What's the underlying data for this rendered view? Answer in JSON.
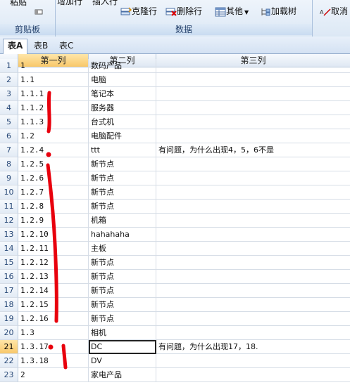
{
  "ribbon": {
    "clipboard_group": "剪贴板",
    "data_group": "数据",
    "paste_label": "粘贴",
    "append_label": "增加行",
    "insert_label": "插入行",
    "clone_label": "克隆行",
    "delete_label": "删除行",
    "other_label": "其他",
    "load_tree_label": "加载树",
    "cancel_label": "取消"
  },
  "tabs": [
    "表A",
    "表B",
    "表C"
  ],
  "columns": [
    "第一列",
    "第二列",
    "第三列"
  ],
  "rows": [
    {
      "n": "1",
      "c1": "1",
      "c2": "数码产品",
      "c3": ""
    },
    {
      "n": "2",
      "c1": "1.1",
      "c2": "电脑",
      "c3": ""
    },
    {
      "n": "3",
      "c1": "1.1.1",
      "c2": "笔记本",
      "c3": ""
    },
    {
      "n": "4",
      "c1": "1.1.2",
      "c2": "服务器",
      "c3": ""
    },
    {
      "n": "5",
      "c1": "1.1.3",
      "c2": "台式机",
      "c3": ""
    },
    {
      "n": "6",
      "c1": "1.2",
      "c2": "电脑配件",
      "c3": ""
    },
    {
      "n": "7",
      "c1": "1.2.4",
      "c2": "ttt",
      "c3": "有问题，为什么出现4，5，6不是"
    },
    {
      "n": "8",
      "c1": "1.2.5",
      "c2": "新节点",
      "c3": ""
    },
    {
      "n": "9",
      "c1": "1.2.6",
      "c2": "新节点",
      "c3": ""
    },
    {
      "n": "10",
      "c1": "1.2.7",
      "c2": "新节点",
      "c3": ""
    },
    {
      "n": "11",
      "c1": "1.2.8",
      "c2": "新节点",
      "c3": ""
    },
    {
      "n": "12",
      "c1": "1.2.9",
      "c2": "机箱",
      "c3": ""
    },
    {
      "n": "13",
      "c1": "1.2.10",
      "c2": "hahahaha",
      "c3": ""
    },
    {
      "n": "14",
      "c1": "1.2.11",
      "c2": "主板",
      "c3": ""
    },
    {
      "n": "15",
      "c1": "1.2.12",
      "c2": "新节点",
      "c3": ""
    },
    {
      "n": "16",
      "c1": "1.2.13",
      "c2": "新节点",
      "c3": ""
    },
    {
      "n": "17",
      "c1": "1.2.14",
      "c2": "新节点",
      "c3": ""
    },
    {
      "n": "18",
      "c1": "1.2.15",
      "c2": "新节点",
      "c3": ""
    },
    {
      "n": "19",
      "c1": "1.2.16",
      "c2": "新节点",
      "c3": ""
    },
    {
      "n": "20",
      "c1": "1.3",
      "c2": "相机",
      "c3": ""
    },
    {
      "n": "21",
      "c1": "1.3.17",
      "c2": "DC",
      "c3": "有问题，为什么出现17，18."
    },
    {
      "n": "22",
      "c1": "1.3.18",
      "c2": "DV",
      "c3": ""
    },
    {
      "n": "23",
      "c1": "2",
      "c2": "家电产品",
      "c3": ""
    }
  ],
  "selected_row": "21",
  "annotation_color": "#e8000d"
}
